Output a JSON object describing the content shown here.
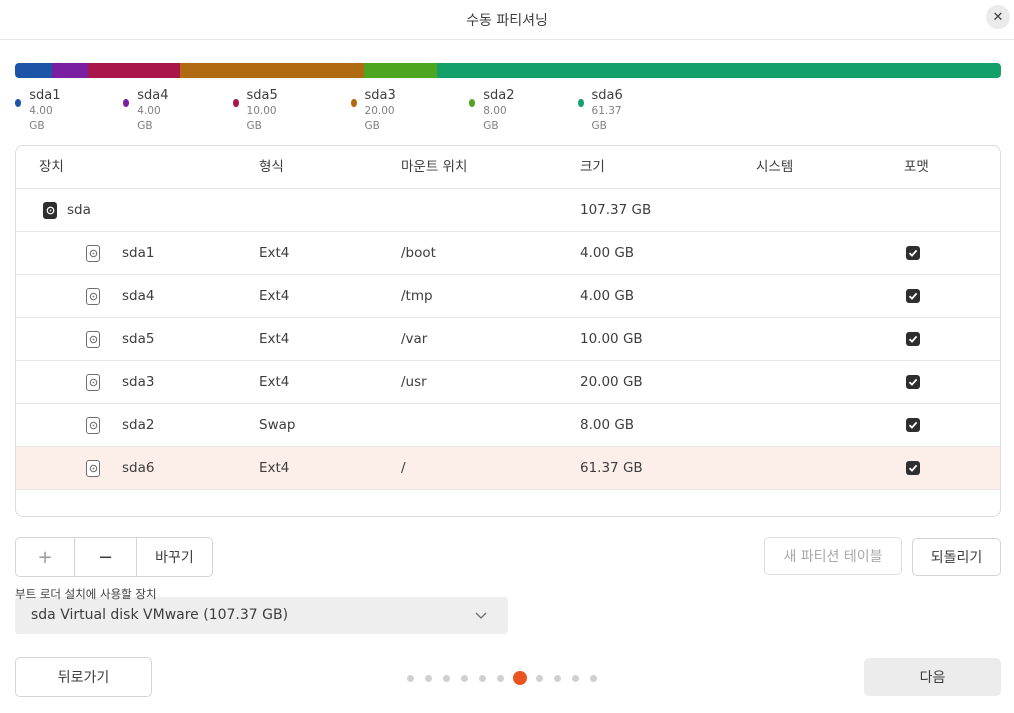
{
  "window": {
    "title": "수동 파티셔닝",
    "close_label": "✕"
  },
  "usage_bar": [
    {
      "name": "sda1",
      "size_gb": 4.0,
      "color": "#1c55a8"
    },
    {
      "name": "sda4",
      "size_gb": 4.0,
      "color": "#7b1fa2"
    },
    {
      "name": "sda5",
      "size_gb": 10.0,
      "color": "#a8164a"
    },
    {
      "name": "sda3",
      "size_gb": 20.0,
      "color": "#b06a12"
    },
    {
      "name": "sda2",
      "size_gb": 8.0,
      "color": "#4ea51f"
    },
    {
      "name": "sda6",
      "size_gb": 61.37,
      "color": "#14a06a"
    }
  ],
  "legend": [
    {
      "name": "sda1",
      "size": "4.00 GB",
      "color": "#1c55a8"
    },
    {
      "name": "sda4",
      "size": "4.00 GB",
      "color": "#7b1fa2"
    },
    {
      "name": "sda5",
      "size": "10.00 GB",
      "color": "#a8164a"
    },
    {
      "name": "sda3",
      "size": "20.00 GB",
      "color": "#b06a12"
    },
    {
      "name": "sda2",
      "size": "8.00 GB",
      "color": "#4ea51f"
    },
    {
      "name": "sda6",
      "size": "61.37 GB",
      "color": "#14a06a"
    }
  ],
  "table": {
    "headers": {
      "device": "장치",
      "type": "형식",
      "mount": "마운트 위치",
      "size": "크기",
      "system": "시스템",
      "format": "포맷"
    },
    "disk": {
      "name": "sda",
      "size": "107.37 GB",
      "icon": "disk-icon"
    },
    "partitions": [
      {
        "name": "sda1",
        "type": "Ext4",
        "mount": "/boot",
        "size": "4.00 GB",
        "system": "",
        "format": true,
        "selected": false
      },
      {
        "name": "sda4",
        "type": "Ext4",
        "mount": "/tmp",
        "size": "4.00 GB",
        "system": "",
        "format": true,
        "selected": false
      },
      {
        "name": "sda5",
        "type": "Ext4",
        "mount": "/var",
        "size": "10.00 GB",
        "system": "",
        "format": true,
        "selected": false
      },
      {
        "name": "sda3",
        "type": "Ext4",
        "mount": "/usr",
        "size": "20.00 GB",
        "system": "",
        "format": true,
        "selected": false
      },
      {
        "name": "sda2",
        "type": "Swap",
        "mount": "",
        "size": "8.00 GB",
        "system": "",
        "format": true,
        "selected": false
      },
      {
        "name": "sda6",
        "type": "Ext4",
        "mount": "/",
        "size": "61.37 GB",
        "system": "",
        "format": true,
        "selected": true
      }
    ]
  },
  "toolbar": {
    "add_label": "+",
    "remove_label": "−",
    "change_label": "바꾸기",
    "new_table_label": "새 파티션 테이블",
    "revert_label": "되돌리기"
  },
  "bootloader": {
    "label": "부트 로더 설치에 사용할 장치",
    "value": "sda Virtual disk VMware (107.37 GB)"
  },
  "footer": {
    "back_label": "뒤로가기",
    "next_label": "다음",
    "page_count": 11,
    "current_page": 7
  },
  "colors": {
    "accent": "#e95420",
    "selected_row": "#fcefea"
  }
}
